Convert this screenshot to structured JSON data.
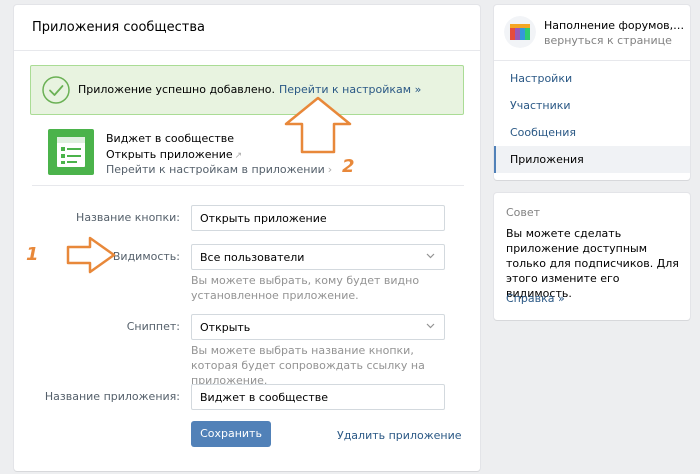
{
  "page_title": "Приложения сообщества",
  "success": {
    "message": "Приложение успешно добавлено.",
    "link": "Перейти к настройкам »"
  },
  "app": {
    "title": "Виджет в сообществе",
    "open_link": "Открыть приложение",
    "settings_link": "Перейти к настройкам в приложении"
  },
  "form": {
    "button_name_label": "Название кнопки:",
    "button_name_value": "Открыть приложение",
    "visibility_label": "Видимость:",
    "visibility_value": "Все пользователи",
    "visibility_hint": "Вы можете выбрать, кому будет видно установленное приложение.",
    "snippet_label": "Сниппет:",
    "snippet_value": "Открыть",
    "snippet_hint": "Вы можете выбрать название кнопки, которая будет сопровождать ссылку на приложение.",
    "app_name_label": "Название приложения:",
    "app_name_value": "Виджет в сообществе",
    "save_label": "Сохранить",
    "delete_label": "Удалить приложение"
  },
  "annotations": {
    "number_1": "1",
    "number_2": "2",
    "accent_color": "#e8883a"
  },
  "nav": {
    "group_name": "Наполнение форумов, гр...",
    "back_link": "вернуться к странице",
    "items": [
      {
        "label": "Настройки",
        "active": false
      },
      {
        "label": "Участники",
        "active": false
      },
      {
        "label": "Сообщения",
        "active": false
      },
      {
        "label": "Приложения",
        "active": true
      }
    ]
  },
  "tip": {
    "title": "Совет",
    "text": "Вы можете сделать приложение доступным только для подписчиков. Для этого измените его видимость.",
    "link": "Справка »"
  },
  "colors": {
    "primary": "#5181b8",
    "link": "#2a5885",
    "success_bg": "#e8f3e0",
    "success_border": "#aadc95",
    "app_icon": "#4bb34b"
  }
}
